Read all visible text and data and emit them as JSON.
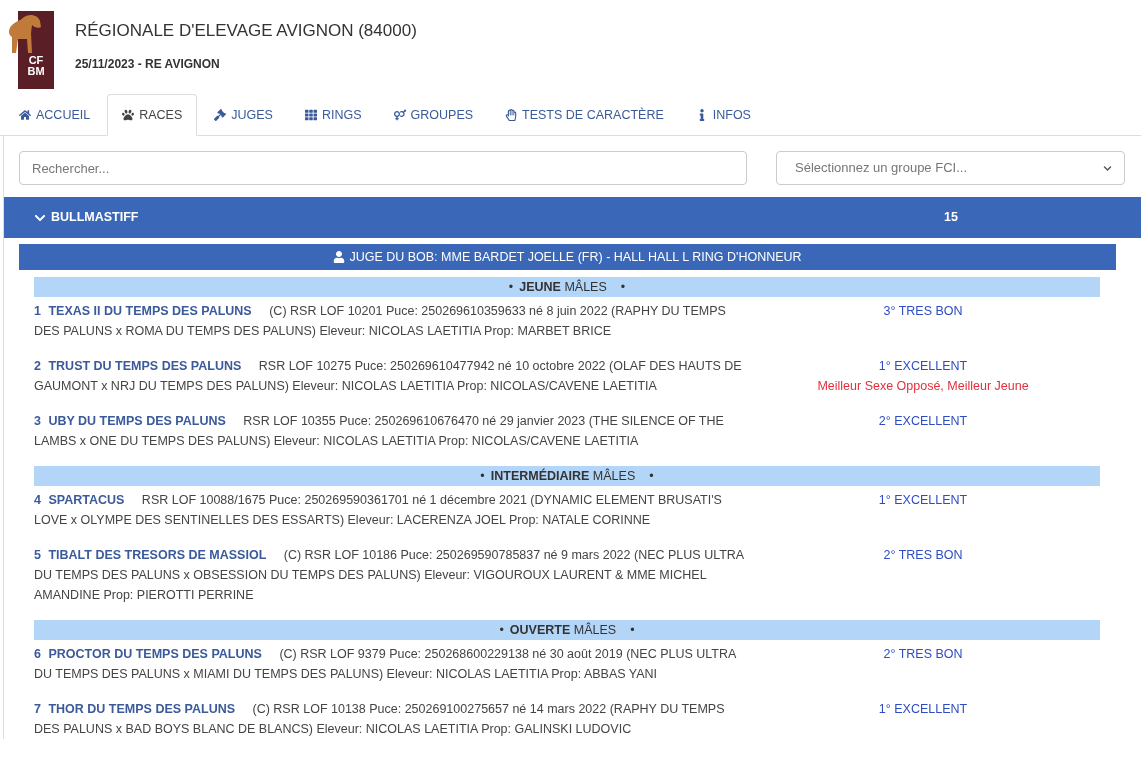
{
  "header": {
    "logo_lines": [
      "CF",
      "BM"
    ],
    "title": "RÉGIONALE D'ELEVAGE AVIGNON (84000)",
    "subtitle": "25/11/2023 - RE AVIGNON"
  },
  "tabs": [
    {
      "label": "ACCUEIL",
      "selected": false
    },
    {
      "label": "RACES",
      "selected": true
    },
    {
      "label": "JUGES",
      "selected": false
    },
    {
      "label": "RINGS",
      "selected": false
    },
    {
      "label": "GROUPES",
      "selected": false
    },
    {
      "label": "TESTS DE CARACTÈRE",
      "selected": false
    },
    {
      "label": "INFOS",
      "selected": false
    }
  ],
  "search": {
    "placeholder": "Rechercher..."
  },
  "group_select": {
    "placeholder": "Sélectionnez un groupe FCI..."
  },
  "breed": {
    "name": "BULLMASTIFF",
    "count": "15",
    "expanded": true
  },
  "judge": "JUGE DU BOB: MME BARDET JOELLE (FR) - HALL HALL L RING D'HONNEUR",
  "classes": [
    {
      "bullet_left": "•",
      "title": "**JEUNE** MÂLES",
      "bullet_right": "•",
      "entries": [
        {
          "number": "1",
          "name": "TEXAS II DU TEMPS DES PALUNS",
          "details": "(C) RSR LOF 10201 Puce: 250269610359633 né 8 juin 2022 (RAPHY DU TEMPS DES PALUNS x ROMA DU TEMPS DES PALUNS) Eleveur: NICOLAS LAETITIA Prop: MARBET BRICE",
          "result": "3° TRES BON"
        },
        {
          "number": "2",
          "name": "TRUST DU TEMPS DES PALUNS",
          "details": "RSR LOF 10275 Puce: 250269610477942 né 10 octobre 2022 (OLAF DES HAUTS DE GAUMONT x NRJ DU TEMPS DES PALUNS) Eleveur: NICOLAS LAETITIA Prop: NICOLAS/CAVENE LAETITIA",
          "result": "1° EXCELLENT",
          "award": "Meilleur Sexe Opposé, Meilleur Jeune"
        },
        {
          "number": "3",
          "name": "UBY DU TEMPS DES PALUNS",
          "details": "RSR LOF 10355 Puce: 250269610676470 né 29 janvier 2023 (THE SILENCE OF THE LAMBS x ONE DU TEMPS DES PALUNS) Eleveur: NICOLAS LAETITIA Prop: NICOLAS/CAVENE LAETITIA",
          "result": "2° EXCELLENT"
        }
      ]
    },
    {
      "bullet_left": "•",
      "title": "**INTERMÉDIAIRE** MÂLES",
      "bullet_right": "•",
      "entries": [
        {
          "number": "4",
          "name": "SPARTACUS",
          "details": "RSR LOF 10088/1675 Puce: 250269590361701 né 1 décembre 2021 (DYNAMIC ELEMENT BRUSATI'S LOVE x OLYMPE DES SENTINELLES DES ESSARTS) Eleveur: LACERENZA JOEL Prop: NATALE CORINNE",
          "result": "1° EXCELLENT"
        },
        {
          "number": "5",
          "name": "TIBALT DES TRESORS DE MASSIOL",
          "details": "(C) RSR LOF 10186 Puce: 250269590785837 né 9 mars 2022 (NEC PLUS ULTRA DU TEMPS DES PALUNS x OBSESSION DU TEMPS DES PALUNS) Eleveur: VIGOUROUX LAURENT & MME MICHEL AMANDINE Prop: PIEROTTI PERRINE",
          "result": "2° TRES BON"
        }
      ]
    },
    {
      "bullet_left": "•",
      "title": "**OUVERTE** MÂLES",
      "bullet_right": "•",
      "entries": [
        {
          "number": "6",
          "name": "PROCTOR DU TEMPS DES PALUNS",
          "details": "(C) RSR LOF 9379 Puce: 250268600229138 né 30 août 2019 (NEC PLUS ULTRA DU TEMPS DES PALUNS x MIAMI DU TEMPS DES PALUNS) Eleveur: NICOLAS LAETITIA Prop: ABBAS YANI",
          "result": "2° TRES BON"
        },
        {
          "number": "7",
          "name": "THOR DU TEMPS DES PALUNS",
          "details": "(C) RSR LOF 10138 Puce: 250269100275657 né 14 mars 2022 (RAPHY DU TEMPS DES PALUNS x BAD BOYS BLANC DE BLANCS) Eleveur: NICOLAS LAETITIA Prop: GALINSKI LUDOVIC",
          "result": "1° EXCELLENT"
        }
      ]
    }
  ]
}
